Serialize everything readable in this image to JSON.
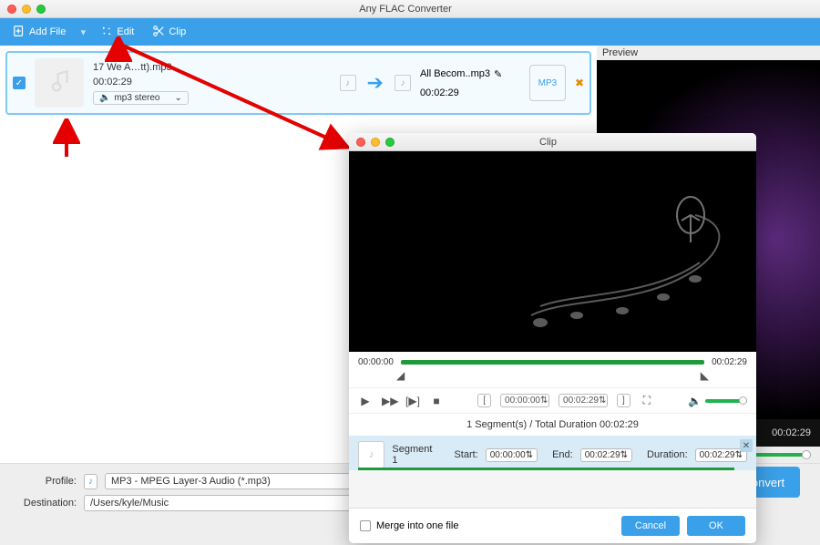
{
  "app": {
    "title": "Any FLAC Converter"
  },
  "toolbar": {
    "add_file": "Add File",
    "edit": "Edit",
    "clip": "Clip"
  },
  "file": {
    "name": "17 We A…tt).mp3",
    "duration": "00:02:29",
    "format": "mp3 stereo",
    "out_name": "All Becom..mp3",
    "out_duration": "00:02:29",
    "out_badge": "MP3"
  },
  "preview": {
    "header": "Preview",
    "time": "00:02:29"
  },
  "profile": {
    "label": "Profile:",
    "value": "MP3 - MPEG Layer-3 Audio (*.mp3)"
  },
  "destination": {
    "label": "Destination:",
    "value": "/Users/kyle/Music"
  },
  "convert_btn": "onvert",
  "clip": {
    "title": "Clip",
    "tl_start": "00:00:00",
    "tl_end": "00:02:29",
    "in_time": "00:00:00",
    "out_time": "00:02:29",
    "seg_summary": "1 Segment(s) / Total Duration 00:02:29",
    "seg_name": "Segment 1",
    "seg_start_label": "Start:",
    "seg_start": "00:00:00",
    "seg_end_label": "End:",
    "seg_end": "00:02:29",
    "seg_dur_label": "Duration:",
    "seg_dur": "00:02:29",
    "merge_label": "Merge into one file",
    "cancel": "Cancel",
    "ok": "OK"
  }
}
